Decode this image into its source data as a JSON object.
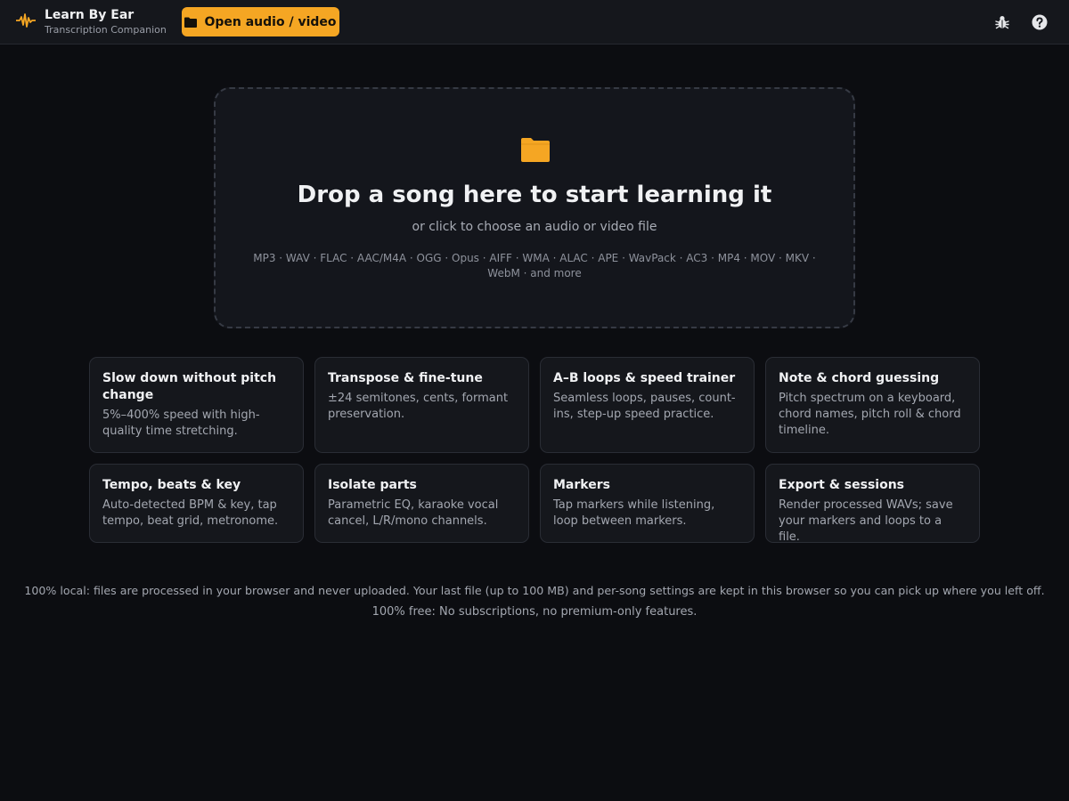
{
  "header": {
    "app_title": "Learn By Ear",
    "app_subtitle": "Transcription Companion",
    "open_button_label": "Open audio / video",
    "icons": {
      "logo": "waveform-icon",
      "open": "folder-icon",
      "debug": "bug-icon",
      "help": "help-icon"
    }
  },
  "dropzone": {
    "title": "Drop a song here to start learning it",
    "subtitle": "or click to choose an audio or video file",
    "formats": "MP3 · WAV · FLAC · AAC/M4A · OGG · Opus · AIFF · WMA · ALAC · APE · WavPack · AC3 · MP4 · MOV · MKV · WebM · and more",
    "icon": "folder-icon"
  },
  "features": [
    {
      "title": "Slow down without pitch change",
      "desc": "5%–400% speed with high-quality time stretching."
    },
    {
      "title": "Transpose & fine-tune",
      "desc": "±24 semitones, cents, formant preservation."
    },
    {
      "title": "A–B loops & speed trainer",
      "desc": "Seamless loops, pauses, count-ins, step-up speed practice."
    },
    {
      "title": "Note & chord guessing",
      "desc": "Pitch spectrum on a keyboard, chord names, pitch roll & chord timeline."
    },
    {
      "title": "Tempo, beats & key",
      "desc": "Auto-detected BPM & key, tap tempo, beat grid, metronome."
    },
    {
      "title": "Isolate parts",
      "desc": "Parametric EQ, karaoke vocal cancel, L/R/mono channels."
    },
    {
      "title": "Markers",
      "desc": "Tap markers while listening, loop between markers."
    },
    {
      "title": "Export & sessions",
      "desc": "Render processed WAVs; save your markers and loops to a file."
    }
  ],
  "footer": {
    "privacy": "100% local: files are processed in your browser and never uploaded. Your last file (up to 100 MB) and per-song settings are kept in this browser so you can pick up where you left off.",
    "pricing": "100% free: No subscriptions, no premium-only features."
  },
  "colors": {
    "accent": "#f5a623",
    "background": "#0c0d11",
    "surface": "#15171c"
  }
}
